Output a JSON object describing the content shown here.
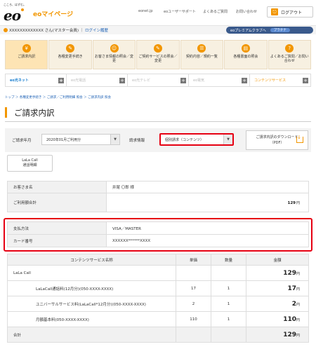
{
  "header": {
    "tagline": "こころ、はずむ。",
    "logo": "eo",
    "mypage": "eoマイページ",
    "links": [
      "eonet.jp",
      "eoユーザーサポート",
      "よくあるご質問",
      "お問い合わせ"
    ],
    "logout": "ログアウト"
  },
  "userbar": {
    "name": "XXXXXXXXXXXXX さん(マスター会員)",
    "login_history": "ログイン履歴",
    "premium": "eoプレミアムクラブへ",
    "premium_badge": "プラチナ"
  },
  "menu": [
    {
      "label": "ご請求内訳",
      "icon": "yen-icon",
      "glyph": "¥"
    },
    {
      "label": "各種変更手続き",
      "icon": "edit-icon",
      "glyph": "✎"
    },
    {
      "label": "お客さま情報の照会／変更",
      "icon": "person-icon",
      "glyph": "☺"
    },
    {
      "label": "ご契約サービスの照会／変更",
      "icon": "doc-icon",
      "glyph": "✎"
    },
    {
      "label": "契約内容／規約一覧",
      "icon": "list-icon",
      "glyph": "☰"
    },
    {
      "label": "各種書面の照会",
      "icon": "document-icon",
      "glyph": "▤"
    },
    {
      "label": "よくあるご質問／お問い合わせ",
      "icon": "question-icon",
      "glyph": "?"
    }
  ],
  "services": [
    "eo光ネット",
    "eo光電話",
    "eo光テレビ",
    "eo電気",
    "コンテンツサービス"
  ],
  "breadcrumb": "トップ ＞ 各種変更手続き ＞ ご請求／ご利用明細 照会 ＞ ご請求内訳 照会",
  "page_title": "ご請求内訳",
  "filter": {
    "month_label": "ご請求年月",
    "month_value": "2020年01月ご利用分",
    "info_label": "請求情報",
    "info_value": "個別請求（コンテンツ）",
    "download": "ご請求内訳のダウンロード",
    "download_sub": "（PDF）"
  },
  "lala_button": {
    "line1": "LaLa Call",
    "line2": "通話明細"
  },
  "customer": {
    "name_label": "お客さま名",
    "name_value": "井尾 〇郎 様",
    "total_label": "ご利用額合計",
    "total_value": "129",
    "yen": "円"
  },
  "payment": {
    "method_label": "支払方法",
    "method_value": "VISA／MASTER",
    "card_label": "カード番号",
    "card_value": "XXXXXX******XXXX"
  },
  "detail": {
    "headers": [
      "コンテンツサービス名称",
      "単価",
      "数量",
      "金額"
    ],
    "rows": [
      {
        "name": "LaLa Call",
        "unit": "",
        "qty": "",
        "amount": "129"
      },
      {
        "name": "LaLaCall通話料(12月分)(050-XXXX-XXXX)",
        "unit": "17",
        "qty": "1",
        "amount": "17"
      },
      {
        "name": "ユニバーサルサービス料(LaLaCall*12月分)(050-XXXX-XXXX)",
        "unit": "2",
        "qty": "1",
        "amount": "2"
      },
      {
        "name": "月額基本料(050-XXXX-XXXX)",
        "unit": "110",
        "qty": "1",
        "amount": "110"
      }
    ],
    "total_label": "合計",
    "total_value": "129"
  },
  "colors": {
    "accent": "#f29600",
    "highlight": "#e60012",
    "link": "#1a5fb4"
  }
}
